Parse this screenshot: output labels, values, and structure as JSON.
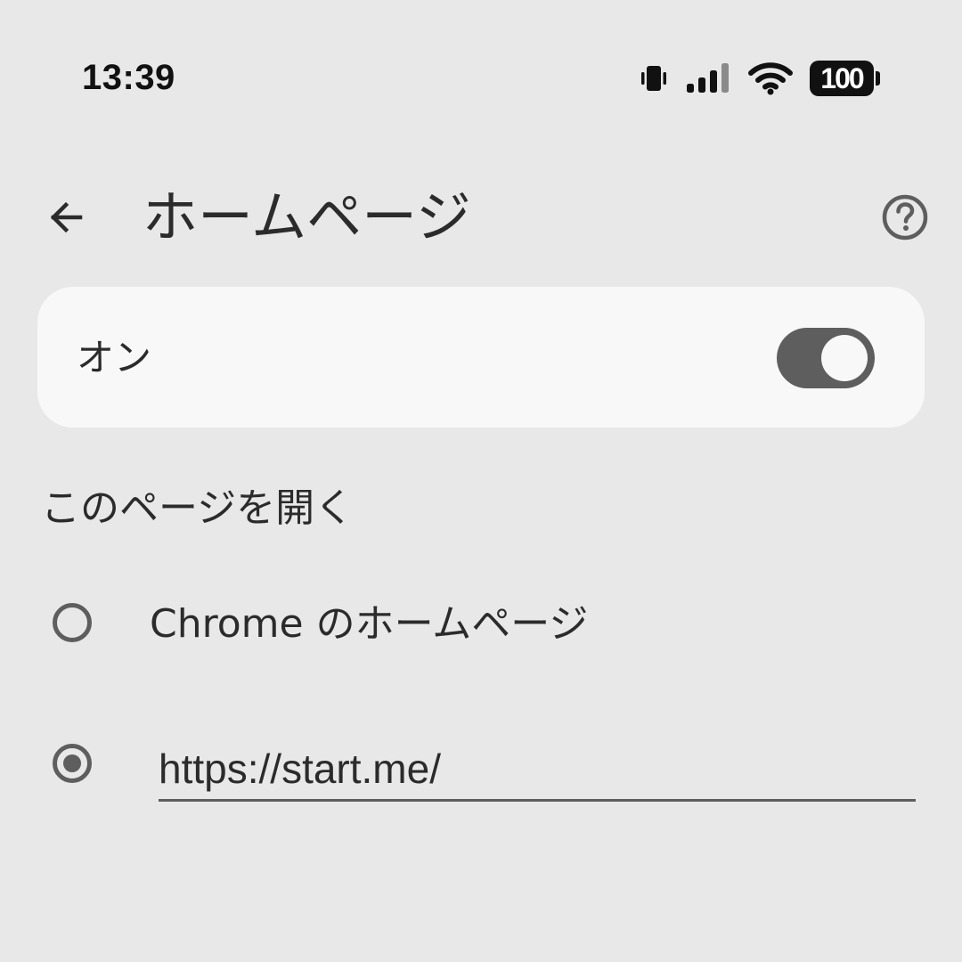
{
  "status_bar": {
    "time": "13:39",
    "battery_level": "100",
    "icons": [
      "vibrate-icon",
      "signal-icon",
      "wifi-icon",
      "battery-icon"
    ]
  },
  "app_bar": {
    "title": "ホームページ",
    "back_icon": "arrow-left-icon",
    "help_icon": "help-circle-icon"
  },
  "switch": {
    "label": "オン",
    "state": "on"
  },
  "section": {
    "title": "このページを開く"
  },
  "options": [
    {
      "label": "Chrome のホームページ",
      "selected": false
    },
    {
      "value": "https://start.me/",
      "selected": true
    }
  ],
  "colors": {
    "background": "#e8e8e8",
    "card": "#f8f8f8",
    "accent": "#5e5e5e",
    "text": "#2b2b2b"
  }
}
